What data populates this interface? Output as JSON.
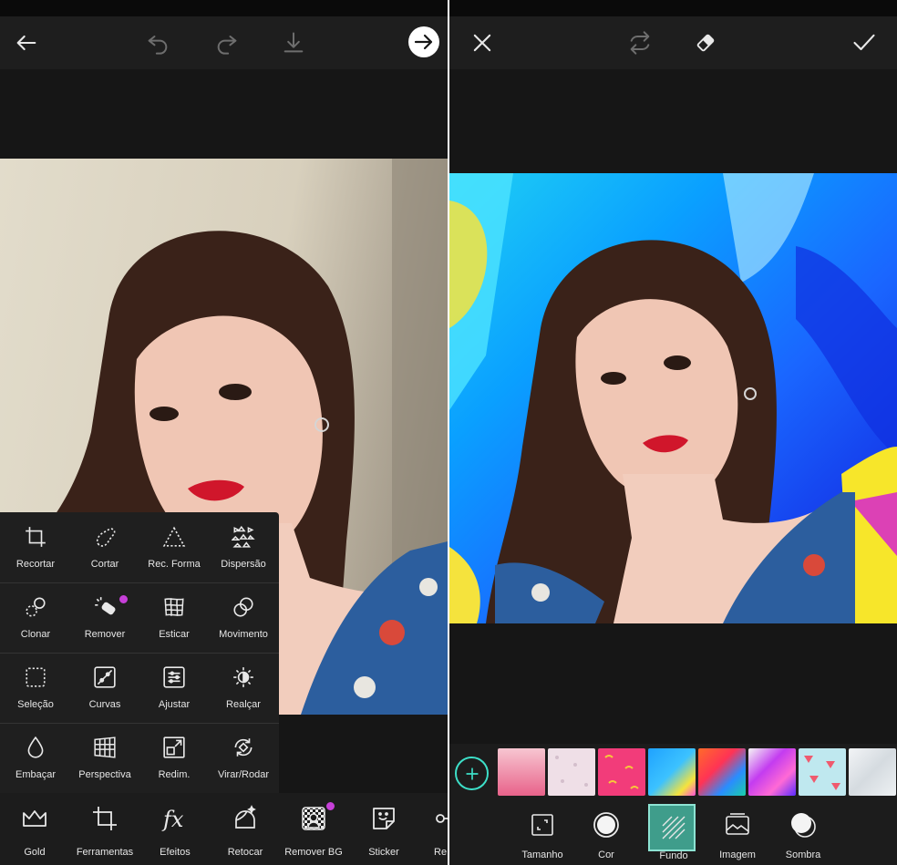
{
  "left_screen": {
    "toolbar": {
      "back_icon": "arrow-left-icon",
      "undo_icon": "undo-icon",
      "redo_icon": "redo-icon",
      "download_icon": "download-icon",
      "next_icon": "arrow-right-circle-icon"
    },
    "tools": [
      {
        "label": "Recortar",
        "icon": "crop-icon"
      },
      {
        "label": "Cortar",
        "icon": "freecrop-icon"
      },
      {
        "label": "Rec. Forma",
        "icon": "shape-crop-icon"
      },
      {
        "label": "Dispersão",
        "icon": "dispersion-icon"
      },
      {
        "label": "Clonar",
        "icon": "clone-icon"
      },
      {
        "label": "Remover",
        "icon": "remove-icon"
      },
      {
        "label": "Esticar",
        "icon": "stretch-icon"
      },
      {
        "label": "Movimento",
        "icon": "motion-icon"
      },
      {
        "label": "Seleção",
        "icon": "selection-icon"
      },
      {
        "label": "Curvas",
        "icon": "curves-icon"
      },
      {
        "label": "Ajustar",
        "icon": "adjust-icon"
      },
      {
        "label": "Realçar",
        "icon": "enhance-icon"
      },
      {
        "label": "Embaçar",
        "icon": "blur-icon"
      },
      {
        "label": "Perspectiva",
        "icon": "perspective-icon"
      },
      {
        "label": "Redim.",
        "icon": "resize-icon"
      },
      {
        "label": "Virar/Rodar",
        "icon": "flip-rotate-icon"
      }
    ],
    "nav": [
      {
        "label": "Gold",
        "icon": "crown-icon"
      },
      {
        "label": "Ferramentas",
        "icon": "crop-tool-icon"
      },
      {
        "label": "Efeitos",
        "icon": "fx-icon"
      },
      {
        "label": "Retocar",
        "icon": "face-retouch-icon"
      },
      {
        "label": "Remover BG",
        "icon": "remove-bg-icon"
      },
      {
        "label": "Sticker",
        "icon": "sticker-icon"
      },
      {
        "label": "Re",
        "icon": "key-icon"
      }
    ]
  },
  "right_screen": {
    "toolbar": {
      "close_icon": "close-icon",
      "swap_icon": "swap-icon",
      "eraser_icon": "eraser-icon",
      "apply_icon": "check-icon"
    },
    "add_icon": "plus-circle-icon",
    "swatches": [
      {
        "name": "pink-gradient",
        "colors": [
          "#f4b8c8",
          "#e96a8c"
        ]
      },
      {
        "name": "pale-pattern",
        "colors": [
          "#f3e3ea",
          "#d9c4d0"
        ]
      },
      {
        "name": "pink-confetti",
        "colors": [
          "#f23c7a",
          "#f7c83a"
        ]
      },
      {
        "name": "blue-paint",
        "colors": [
          "#1fa2ff",
          "#f5e33d"
        ]
      },
      {
        "name": "orange-paint",
        "colors": [
          "#ff6a2a",
          "#2a8cff"
        ]
      },
      {
        "name": "purple-paint",
        "colors": [
          "#c33cf0",
          "#ff6ad5"
        ]
      },
      {
        "name": "watermelon",
        "colors": [
          "#bfe8ef",
          "#ef5a6e"
        ]
      },
      {
        "name": "marble",
        "colors": [
          "#e9edf0",
          "#c8d0d6"
        ]
      }
    ],
    "nav": [
      {
        "label": "Tamanho",
        "icon": "resize-frame-icon",
        "active": false
      },
      {
        "label": "Cor",
        "icon": "color-circle-icon",
        "active": false
      },
      {
        "label": "Fundo",
        "icon": "stripes-icon",
        "active": true
      },
      {
        "label": "Imagem",
        "icon": "image-icon",
        "active": false
      },
      {
        "label": "Sombra",
        "icon": "shadow-icon",
        "active": false
      }
    ]
  },
  "colors": {
    "accent": "#3ddfc8",
    "active_bg": "#3f9d8b",
    "panel_bg": "#161616",
    "pro_badge": "#c63fd8"
  }
}
